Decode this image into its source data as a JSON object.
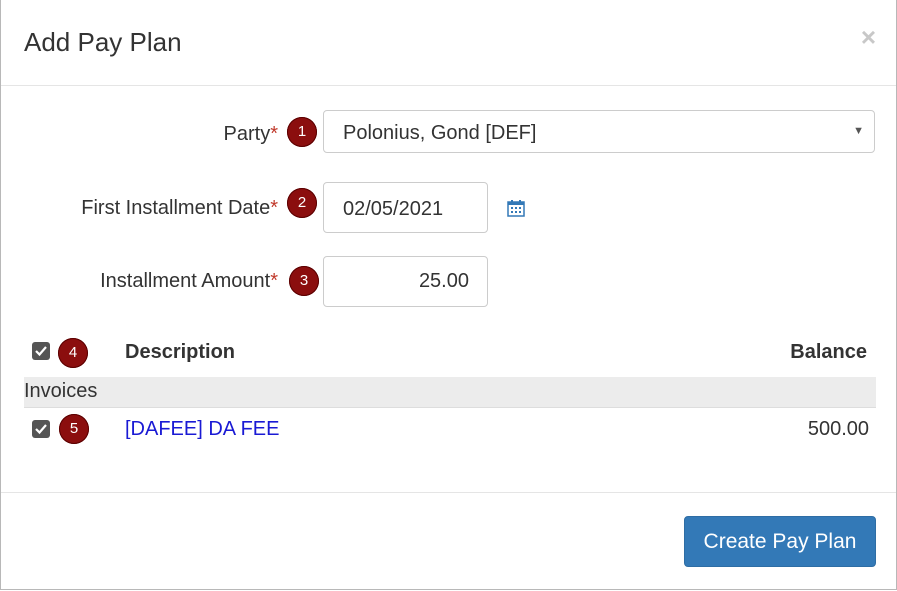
{
  "dialog": {
    "title": "Add Pay Plan",
    "close_label": "×"
  },
  "form": {
    "party": {
      "label": "Party",
      "required_mark": "*",
      "badge": "1",
      "selected_value": "Polonius, Gond [DEF]"
    },
    "first_installment_date": {
      "label": "First Installment Date",
      "required_mark": "*",
      "badge": "2",
      "value": "02/05/2021"
    },
    "installment_amount": {
      "label": "Installment Amount",
      "required_mark": "*",
      "badge": "3",
      "value": "25.00"
    }
  },
  "table": {
    "header_badge": "4",
    "columns": {
      "description": "Description",
      "balance": "Balance"
    },
    "group_label": "Invoices",
    "rows": [
      {
        "badge": "5",
        "description": "[DAFEE] DA FEE",
        "balance": "500.00",
        "checked": true
      }
    ]
  },
  "footer": {
    "create_label": "Create Pay Plan"
  },
  "colors": {
    "badge": "#8b0e0e",
    "primary": "#3379b7",
    "link": "#1a1ad4",
    "required": "#c0392b"
  }
}
